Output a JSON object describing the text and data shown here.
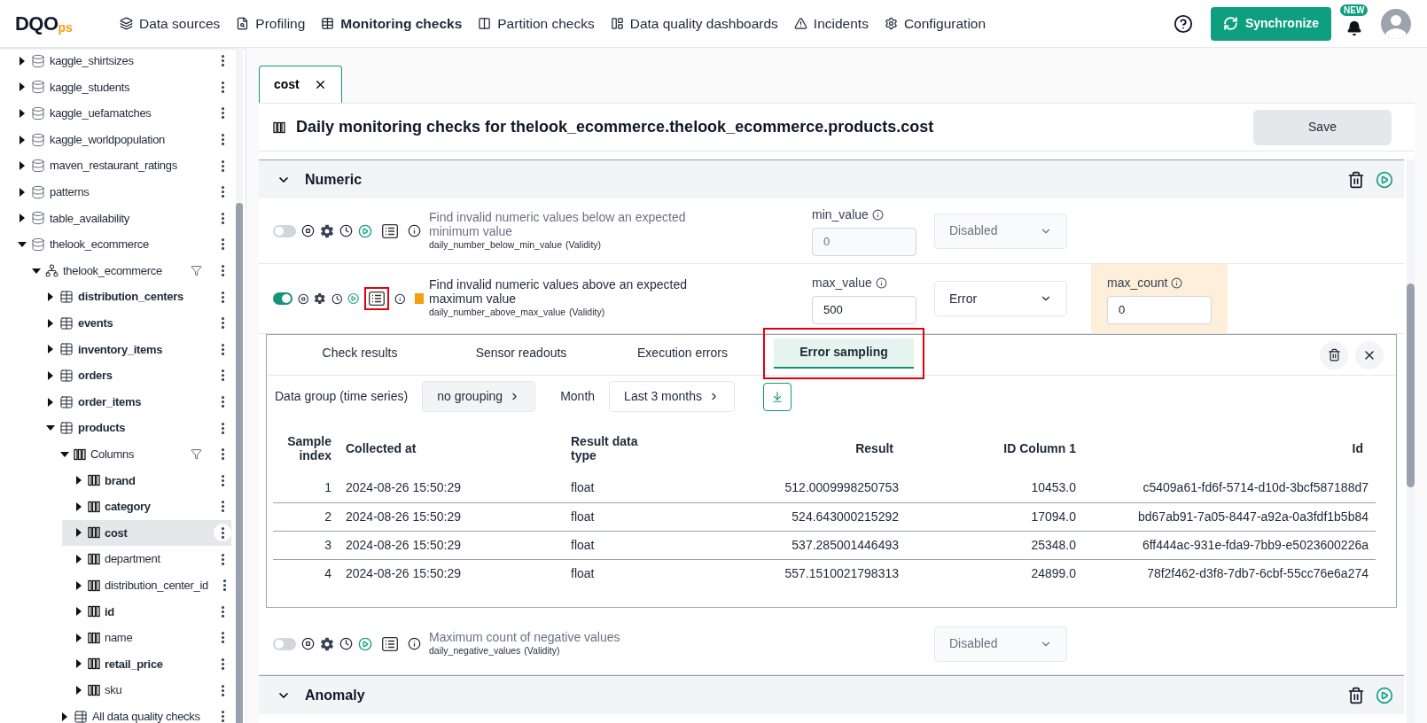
{
  "logo": {
    "main": "DQO",
    "suffix": "ps"
  },
  "nav": [
    {
      "label": "Data sources",
      "selected": false
    },
    {
      "label": "Profiling",
      "selected": false
    },
    {
      "label": "Monitoring checks",
      "selected": true
    },
    {
      "label": "Partition checks",
      "selected": false
    },
    {
      "label": "Data quality dashboards",
      "selected": false
    },
    {
      "label": "Incidents",
      "selected": false
    },
    {
      "label": "Configuration",
      "selected": false
    }
  ],
  "sync_button": "Synchronize",
  "notification_badge": "NEW",
  "tree": [
    {
      "kind": "database",
      "label": "kaggle_shirtsizes",
      "expanded": false,
      "bold": false,
      "selected": false
    },
    {
      "kind": "database",
      "label": "kaggle_students",
      "expanded": false,
      "bold": false,
      "selected": false
    },
    {
      "kind": "database",
      "label": "kaggle_uefamatches",
      "expanded": false,
      "bold": false,
      "selected": false
    },
    {
      "kind": "database",
      "label": "kaggle_worldpopulation",
      "expanded": false,
      "bold": false,
      "selected": false
    },
    {
      "kind": "database",
      "label": "maven_restaurant_ratings",
      "expanded": false,
      "bold": false,
      "selected": false
    },
    {
      "kind": "database",
      "label": "patterns",
      "expanded": false,
      "bold": false,
      "selected": false
    },
    {
      "kind": "database",
      "label": "table_availability",
      "expanded": false,
      "bold": false,
      "selected": false
    },
    {
      "kind": "database",
      "label": "thelook_ecommerce",
      "expanded": true,
      "bold": false,
      "selected": false,
      "children": [
        {
          "kind": "schema",
          "label": "thelook_ecommerce",
          "expanded": true,
          "bold": false,
          "selected": false,
          "filter": true,
          "children": [
            {
              "kind": "table",
              "label": "distribution_centers",
              "expanded": false,
              "bold": true,
              "selected": false
            },
            {
              "kind": "table",
              "label": "events",
              "expanded": false,
              "bold": true,
              "selected": false
            },
            {
              "kind": "table",
              "label": "inventory_items",
              "expanded": false,
              "bold": true,
              "selected": false
            },
            {
              "kind": "table",
              "label": "orders",
              "expanded": false,
              "bold": true,
              "selected": false
            },
            {
              "kind": "table",
              "label": "order_items",
              "expanded": false,
              "bold": true,
              "selected": false
            },
            {
              "kind": "table",
              "label": "products",
              "expanded": true,
              "bold": true,
              "selected": false,
              "children": [
                {
                  "kind": "columns",
                  "label": "Columns",
                  "expanded": true,
                  "bold": false,
                  "selected": false,
                  "filter": true,
                  "children": [
                    {
                      "kind": "column",
                      "label": "brand",
                      "expanded": false,
                      "bold": true,
                      "selected": false
                    },
                    {
                      "kind": "column",
                      "label": "category",
                      "expanded": false,
                      "bold": true,
                      "selected": false
                    },
                    {
                      "kind": "column",
                      "label": "cost",
                      "expanded": false,
                      "bold": true,
                      "selected": true
                    },
                    {
                      "kind": "column",
                      "label": "department",
                      "expanded": false,
                      "bold": false,
                      "selected": false
                    },
                    {
                      "kind": "column",
                      "label": "distribution_center_id",
                      "expanded": false,
                      "bold": false,
                      "selected": false
                    },
                    {
                      "kind": "column",
                      "label": "id",
                      "expanded": false,
                      "bold": true,
                      "selected": false
                    },
                    {
                      "kind": "column",
                      "label": "name",
                      "expanded": false,
                      "bold": false,
                      "selected": false
                    },
                    {
                      "kind": "column",
                      "label": "retail_price",
                      "expanded": false,
                      "bold": true,
                      "selected": false
                    },
                    {
                      "kind": "column",
                      "label": "sku",
                      "expanded": false,
                      "bold": false,
                      "selected": false
                    }
                  ]
                },
                {
                  "kind": "checks",
                  "label": "All data quality checks",
                  "expanded": false,
                  "bold": false,
                  "selected": false
                }
              ]
            }
          ]
        }
      ]
    }
  ],
  "open_tabs": [
    {
      "label": "cost",
      "selected": true
    }
  ],
  "title": "Daily monitoring checks for thelook_ecommerce.thelook_ecommerce.products.cost",
  "save_button": "Save",
  "sections": [
    {
      "title": "Numeric",
      "expanded": true,
      "checks": [
        {
          "enabled": false,
          "highlighted": false,
          "description": "Find invalid numeric values below an expected minimum value",
          "name": "daily_number_below_min_value",
          "category": "(Validity)",
          "parameter": {
            "label": "min_value",
            "value": "0",
            "disabled": true
          },
          "severity": {
            "value": "Disabled",
            "disabled": true
          }
        },
        {
          "enabled": true,
          "highlighted": true,
          "color": "#f59e0b",
          "description": "Find invalid numeric values above an expected maximum value",
          "name": "daily_number_above_max_value",
          "category": "(Validity)",
          "parameter": {
            "label": "max_value",
            "value": "500",
            "disabled": false
          },
          "severity": {
            "value": "Error",
            "disabled": false
          },
          "rule": {
            "label": "max_count",
            "value": "0"
          },
          "results": {
            "tabs": [
              {
                "label": "Check results",
                "selected": false,
                "highlighted": false
              },
              {
                "label": "Sensor readouts",
                "selected": false,
                "highlighted": false
              },
              {
                "label": "Execution errors",
                "selected": false,
                "highlighted": false
              },
              {
                "label": "Error sampling",
                "selected": true,
                "highlighted": true
              }
            ],
            "data_group": {
              "label": "Data group (time series)",
              "value": "no grouping"
            },
            "month": {
              "label": "Month",
              "value": "Last 3 months"
            },
            "columns": [
              "Sample index",
              "Collected at",
              "Result data type",
              "Result",
              "ID Column 1",
              "Id"
            ],
            "rows": [
              [
                "1",
                "2024-08-26 15:50:29",
                "float",
                "512.0009998250753",
                "10453.0",
                "c5409a61-fd6f-5714-d10d-3bcf587188d7"
              ],
              [
                "2",
                "2024-08-26 15:50:29",
                "float",
                "524.643000215292",
                "17094.0",
                "bd67ab91-7a05-8447-a92a-0a3fdf1b5b84"
              ],
              [
                "3",
                "2024-08-26 15:50:29",
                "float",
                "537.285001446493",
                "25348.0",
                "6ff444ac-931e-fda9-7bb9-e5023600226a"
              ],
              [
                "4",
                "2024-08-26 15:50:29",
                "float",
                "557.1510021798313",
                "24899.0",
                "78f2f462-d3f8-7db7-6cbf-55cc76e6a274"
              ]
            ]
          }
        },
        {
          "enabled": false,
          "highlighted": false,
          "description": "Maximum count of negative values",
          "name": "daily_negative_values",
          "category": "(Validity)",
          "severity": {
            "value": "Disabled",
            "disabled": true
          }
        }
      ]
    },
    {
      "title": "Anomaly",
      "expanded": true
    }
  ]
}
